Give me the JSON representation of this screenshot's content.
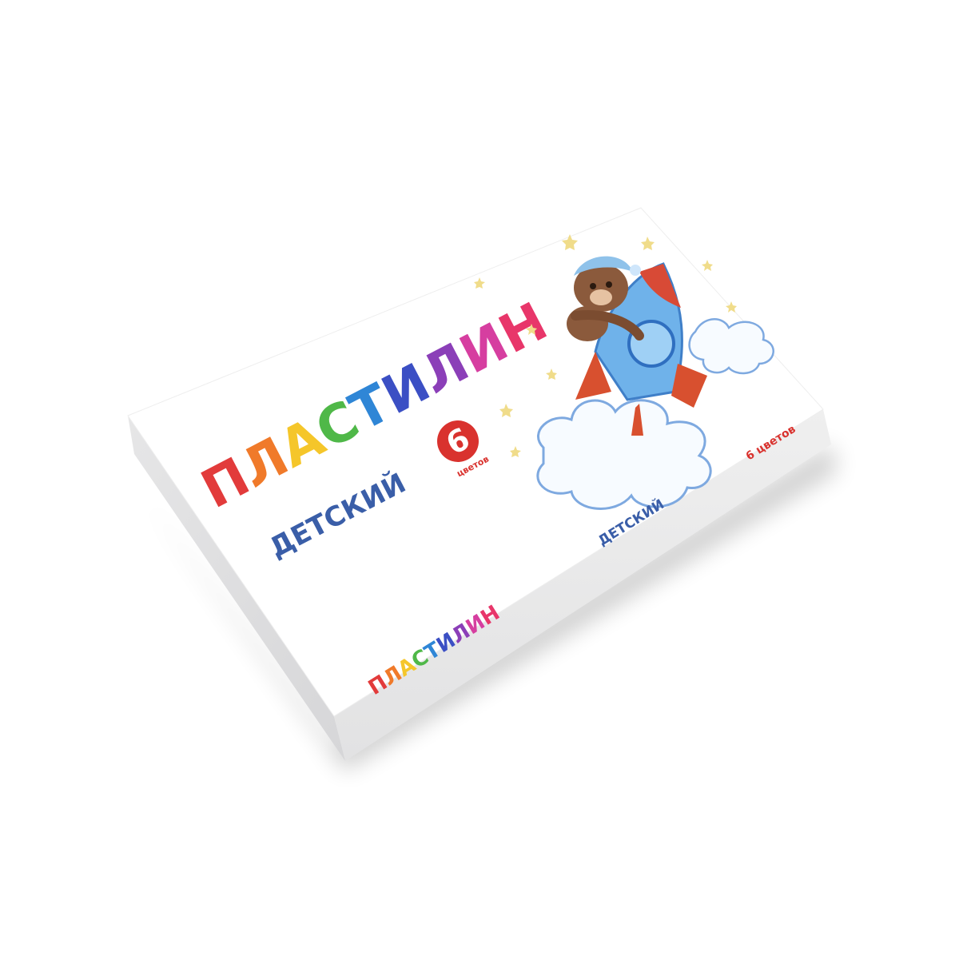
{
  "product": {
    "title_letters": [
      "П",
      "Л",
      "А",
      "С",
      "Т",
      "И",
      "Л",
      "И",
      "Н"
    ],
    "title_colors": [
      "#e23b3b",
      "#f07a2a",
      "#f5c62a",
      "#4fb848",
      "#2f86d6",
      "#3b4fc4",
      "#8b3fb8",
      "#d63ea0",
      "#e8366a"
    ],
    "subtitle": "ДЕТСКИЙ",
    "badge_number": "6",
    "badge_word": "цветов"
  },
  "spine": {
    "title_letters": [
      "П",
      "Л",
      "А",
      "С",
      "Т",
      "И",
      "Л",
      "И",
      "Н"
    ],
    "subtitle": "ДЕТСКИЙ",
    "count_label": "6 цветов"
  },
  "colors": {
    "subtitle_blue": "#3a5ea8",
    "badge_red": "#d9322e",
    "box_top": "#ffffff",
    "box_side": "#e9e9ea"
  }
}
